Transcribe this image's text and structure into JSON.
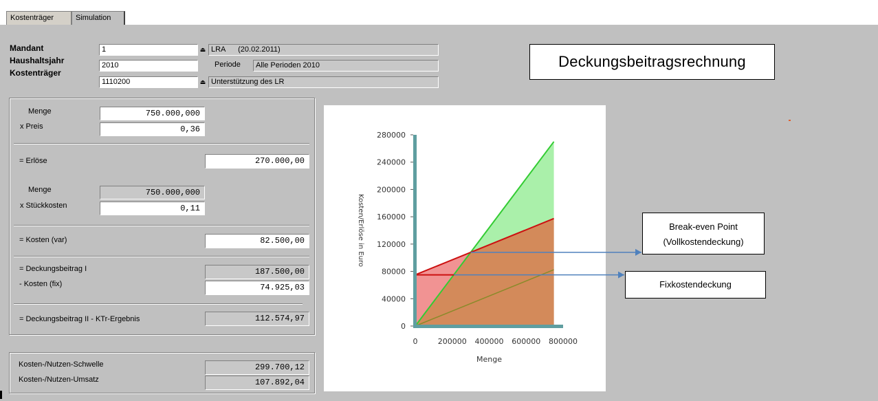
{
  "tabs": [
    {
      "label": "Kostenträger"
    },
    {
      "label": "Simulation"
    }
  ],
  "header": {
    "mandant_label": "Mandant",
    "mandant_value": "1",
    "mandant_desc": "LRA      (20.02.2011)",
    "haushaltsjahr_label": "Haushaltsjahr",
    "haushaltsjahr_value": "2010",
    "periode_label": "Periode",
    "periode_value": "Alle Perioden 2010",
    "kostentraeger_label": "Kostenträger",
    "kostentraeger_value": "1110200",
    "kostentraeger_desc": "Unterstützung des LR"
  },
  "title": "Deckungsbeitragsrechnung",
  "calc": {
    "menge_label": "Menge",
    "menge_value": "750.000,000",
    "preis_label": "x Preis",
    "preis_value": "0,36",
    "erloese_label": "= Erlöse",
    "erloese_value": "270.000,00",
    "menge2_label": "Menge",
    "menge2_value": "750.000,000",
    "stueckkosten_label": "x Stückkosten",
    "stueckkosten_value": "0,11",
    "kosten_var_label": "= Kosten (var)",
    "kosten_var_value": "82.500,00",
    "db1_label": "= Deckungsbeitrag I",
    "db1_value": "187.500,00",
    "kosten_fix_label": "- Kosten (fix)",
    "kosten_fix_value": "74.925,03",
    "db2_label": "= Deckungsbeitrag II - KTr-Ergebnis",
    "db2_value": "112.574,97"
  },
  "threshold": {
    "schwelle_label": "Kosten-/Nutzen-Schwelle",
    "schwelle_value": "299.700,12",
    "umsatz_label": "Kosten-/Nutzen-Umsatz",
    "umsatz_value": "107.892,04"
  },
  "annotations": {
    "break_even_line1": "Break-even Point",
    "break_even_line2": "(Vollkostendeckung)",
    "fixkosten": "Fixkostendeckung"
  },
  "colors": {
    "revenue": "#33cc33",
    "revenue_fill": "#aaf0aa",
    "cost": "#cc1111",
    "cost_fill": "#ee8080",
    "axis": "#5f9ea0",
    "arrow": "#4f81bd"
  },
  "chart_data": {
    "type": "line",
    "xlabel": "Menge",
    "ylabel": "Kosten/Erlöse in Euro",
    "xlim": [
      0,
      800000
    ],
    "ylim": [
      0,
      280000
    ],
    "xticks": [
      "0",
      "200000",
      "400000",
      "600000",
      "800000"
    ],
    "yticks": [
      "0",
      "40000",
      "80000",
      "120000",
      "160000",
      "200000",
      "240000",
      "280000"
    ],
    "x": [
      0,
      750000
    ],
    "series": [
      {
        "values": [
          0,
          270000
        ],
        "color": "#33cc33"
      },
      {
        "values": [
          74925,
          157425
        ],
        "color": "#cc1111"
      },
      {
        "values": [
          0,
          82500
        ],
        "color": "#8a8a2a"
      }
    ],
    "fixed_cost_line": 74925
  }
}
